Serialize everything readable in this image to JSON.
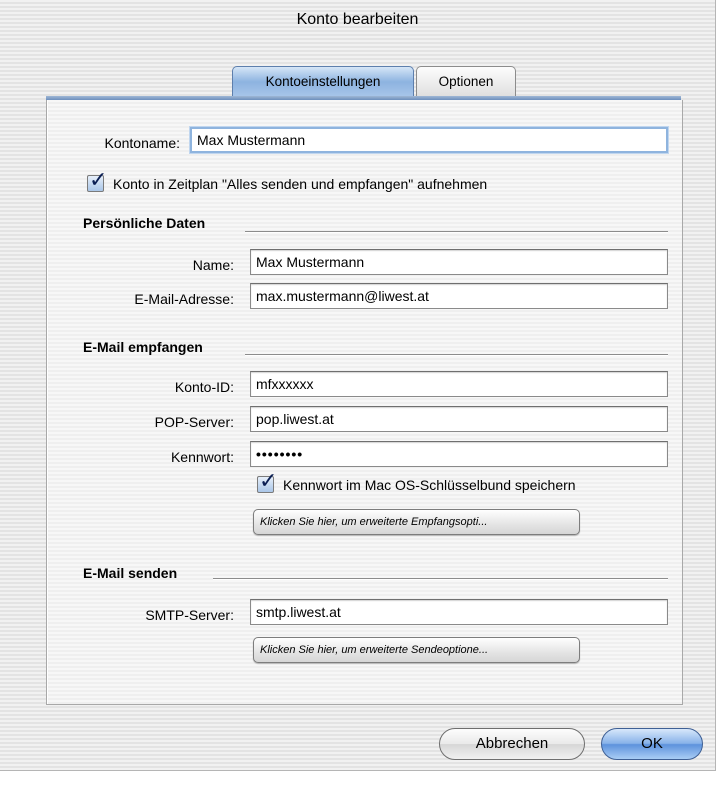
{
  "window": {
    "title": "Konto bearbeiten"
  },
  "tabs": [
    {
      "label": "Kontoeinstellungen",
      "active": true
    },
    {
      "label": "Optionen",
      "active": false
    }
  ],
  "account": {
    "name_label": "Kontoname:",
    "name_value": "Max Mustermann",
    "schedule_checkbox_label": "Konto in Zeitplan \"Alles senden und empfangen\" aufnehmen",
    "schedule_checked": true
  },
  "personal": {
    "section_title": "Persönliche Daten",
    "name_label": "Name:",
    "name_value": "Max Mustermann",
    "email_label": "E-Mail-Adresse:",
    "email_value": "max.mustermann@liwest.at"
  },
  "receive": {
    "section_title": "E-Mail empfangen",
    "account_id_label": "Konto-ID:",
    "account_id_value": "mfxxxxxx",
    "pop_label": "POP-Server:",
    "pop_value": "pop.liwest.at",
    "password_label": "Kennwort:",
    "password_value": "••••••••",
    "keychain_checkbox_label": "Kennwort im Mac OS-Schlüsselbund speichern",
    "keychain_checked": true,
    "advanced_button": "Klicken Sie hier, um erweiterte Empfangsopti..."
  },
  "send": {
    "section_title": "E-Mail senden",
    "smtp_label": "SMTP-Server:",
    "smtp_value": "smtp.liwest.at",
    "advanced_button": "Klicken Sie hier, um erweiterte Sendeoptione..."
  },
  "buttons": {
    "cancel": "Abbrechen",
    "ok": "OK"
  },
  "colors": {
    "accent": "#6d8fbd",
    "default_button": "#5d92dc",
    "checkmark": "#0b1f53"
  }
}
